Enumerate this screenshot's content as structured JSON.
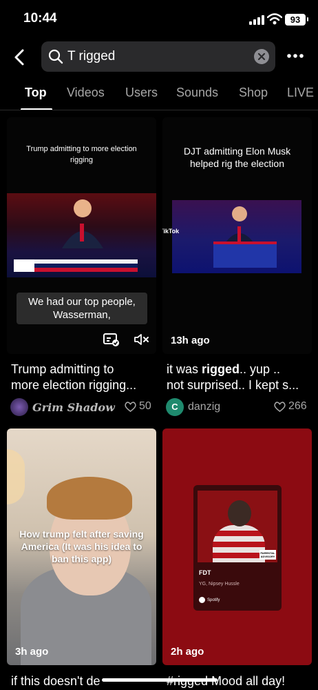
{
  "status_bar": {
    "time": "10:44",
    "battery": "93"
  },
  "search": {
    "query": "T rigged"
  },
  "tabs": [
    {
      "label": "Top"
    },
    {
      "label": "Videos"
    },
    {
      "label": "Users"
    },
    {
      "label": "Sounds"
    },
    {
      "label": "Shop"
    },
    {
      "label": "LIVE"
    }
  ],
  "results": [
    {
      "overlay_top": "Trump admitting to more election rigging",
      "overlay_subtitle": "We had our top people, Wasserman,",
      "caption_line1": "Trump admitting to",
      "caption_line2": "more election rigging...",
      "author": "Grim Shadow",
      "likes": "50"
    },
    {
      "overlay_top": "DJT admitting Elon Musk helped rig the election",
      "watermark": "TikTok",
      "age": "13h ago",
      "caption_prefix": "it was ",
      "caption_highlight": "rigged",
      "caption_suffix": ".. yup ..",
      "caption_line2": "not surprised.. I kept s...",
      "author": "danzig",
      "author_initial": "C",
      "likes": "266"
    },
    {
      "overlay_text": "How trump felt after saving America (It was his idea to ban this app)",
      "age": "3h ago",
      "caption_line1": "if this doesn't de"
    },
    {
      "song_title": "FDT",
      "song_artists": "YG, Nipsey Hussle",
      "platform": "Spotify",
      "age": "2h ago",
      "caption_line1": "#rigged Mood all day!"
    }
  ],
  "colors": {
    "background": "#000000",
    "search_bg": "#2a2a2c",
    "muted_text": "#a7a7a7",
    "card4_bg": "#8c0b12",
    "avatar2": "#1f8a6e"
  }
}
